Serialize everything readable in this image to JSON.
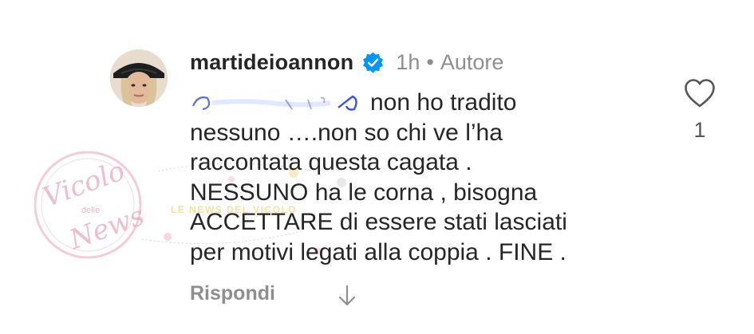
{
  "comment": {
    "username": "martideioannon",
    "time": "1h",
    "separator": "•",
    "author_badge": "Autore",
    "lines": [
      "non ho tradito",
      "nessuno ….non so chi ve l’ha",
      "raccontata questa cagata .",
      "NESSUNO ha le corna , bisogna",
      "ACCETTARE di essere stati lasciati",
      "per motivi legati alla coppia . FINE ."
    ],
    "redacted_mention_icon": "scribble-redaction",
    "like_count": "1",
    "reply_label": "Rispondi",
    "icons": {
      "verified": "verified-badge-icon",
      "like": "heart-outline-icon",
      "translate": "arrow-down-icon"
    }
  },
  "watermark": {
    "line1": "Vicolo",
    "line2": "delle",
    "line3": "News",
    "band": "LE NEWS DEL VICOLO"
  },
  "colors": {
    "text": "#262626",
    "muted": "#8e8e8e",
    "verified": "#0095f6",
    "watermark_pink": "#e7a3b8",
    "watermark_yellow": "#f2d27a"
  }
}
